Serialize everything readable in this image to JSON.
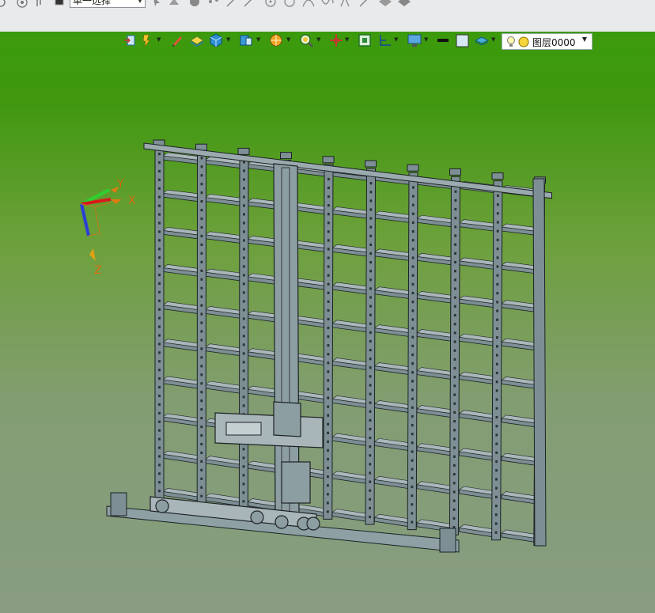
{
  "toolbar": {
    "selection_mode": "单一选择"
  },
  "view_toolbar": {
    "layer_name": "图层0000"
  },
  "axes": {
    "x_label": "X",
    "y_label": "Y",
    "z_label": "Z"
  },
  "colors": {
    "viewport_top": "#3b9a0c",
    "viewport_bottom": "#889d82",
    "model_fill": "#7d8f94",
    "model_edge": "#1c2224",
    "axis_label": "#d86a10"
  },
  "icons": [
    "rotate-icon",
    "pan-icon",
    "color-swatch-icon",
    "select-mode-dropdown",
    "view-cube-icon",
    "section-icon",
    "render-mode-icon",
    "zoom-icon",
    "light-bulb-icon",
    "layer-icon"
  ]
}
